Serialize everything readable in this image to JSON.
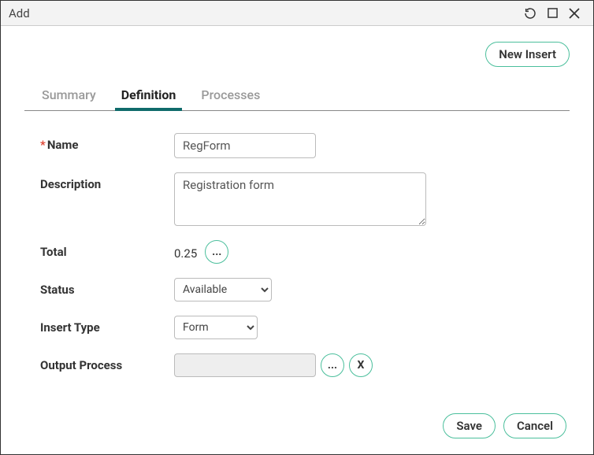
{
  "titlebar": {
    "title": "Add"
  },
  "actions": {
    "new_insert": "New Insert",
    "save": "Save",
    "cancel": "Cancel"
  },
  "tabs": {
    "summary": "Summary",
    "definition": "Definition",
    "processes": "Processes"
  },
  "form": {
    "name_label": "Name",
    "name_value": "RegForm",
    "description_label": "Description",
    "description_value": "Registration form",
    "total_label": "Total",
    "total_value": "0.25",
    "status_label": "Status",
    "status_value": "Available",
    "insert_type_label": "Insert Type",
    "insert_type_value": "Form",
    "output_process_label": "Output Process",
    "output_process_value": ""
  },
  "glyphs": {
    "ellipsis": "...",
    "clear": "X"
  }
}
